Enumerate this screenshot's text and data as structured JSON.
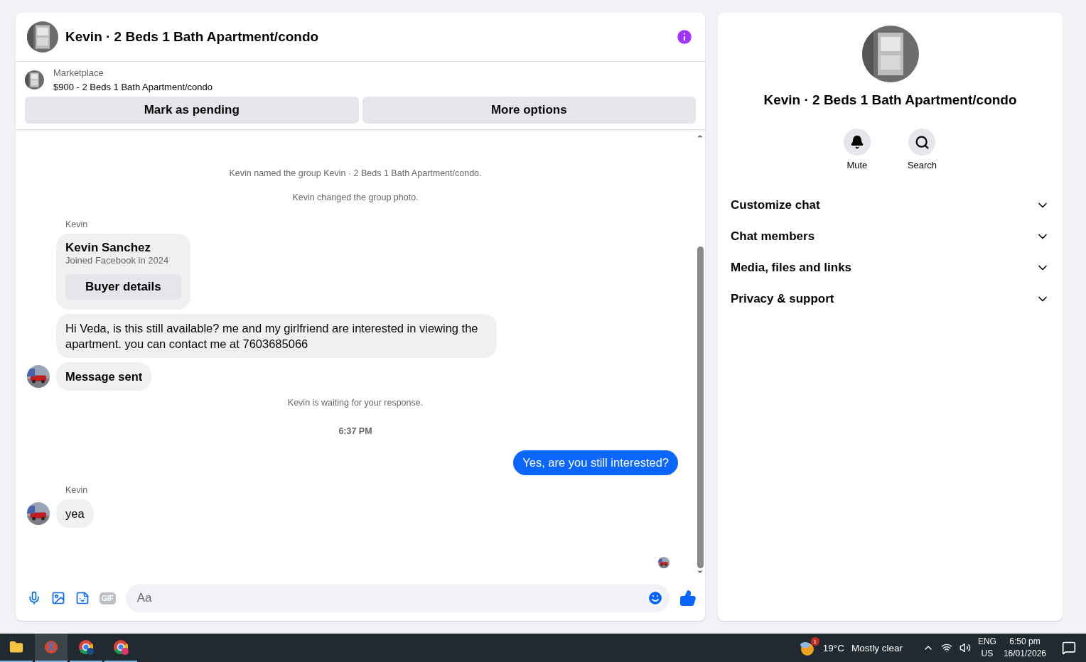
{
  "conversation": {
    "title": "Kevin · 2 Beds 1 Bath Apartment/condo",
    "listing": {
      "source": "Marketplace",
      "summary": "$900 - 2 Beds 1 Bath Apartment/condo"
    },
    "actions": [
      "Mark as pending",
      "More options"
    ],
    "messages": [
      {
        "kind": "notice",
        "text": "Kevin named the group Kevin · 2 Beds 1 Bath Apartment/condo."
      },
      {
        "kind": "notice",
        "text": "Kevin changed the group photo."
      },
      {
        "kind": "sender",
        "text": "Kevin"
      },
      {
        "kind": "profile",
        "name": "Kevin Sanchez",
        "detail": "Joined Facebook in 2024",
        "button": "Buyer details"
      },
      {
        "kind": "incoming",
        "text": "Hi Veda, is this still available? me and my girlfriend are interested in viewing the apartment. you can contact me at 7603685066",
        "avatar": false,
        "bold": false
      },
      {
        "kind": "incoming",
        "text": "Message sent",
        "avatar": true,
        "bold": true
      },
      {
        "kind": "notice",
        "text": "Kevin is waiting for your response."
      },
      {
        "kind": "time",
        "text": "6:37 PM"
      },
      {
        "kind": "outgoing",
        "text": "Yes, are you still interested?"
      },
      {
        "kind": "sender",
        "text": "Kevin"
      },
      {
        "kind": "incoming",
        "text": "yea",
        "avatar": true,
        "bold": false
      }
    ],
    "composer": {
      "gif_label": "GIF",
      "placeholder": "Aa"
    }
  },
  "details": {
    "title": "Kevin · 2 Beds 1 Bath Apartment/condo",
    "quick_actions": [
      {
        "kind": "mute",
        "label": "Mute"
      },
      {
        "kind": "search",
        "label": "Search"
      }
    ],
    "sections": [
      {
        "label": "Customize chat",
        "expanded": false
      },
      {
        "label": "Chat members",
        "expanded": false
      },
      {
        "label": "Media, files and links",
        "expanded": false
      },
      {
        "label": "Privacy & support",
        "expanded": false
      }
    ]
  },
  "taskbar": {
    "weather": {
      "badge": "1",
      "temperature": "19°C",
      "condition": "Mostly clear"
    },
    "language": "ENG",
    "region": "US",
    "time": "6:50 pm",
    "date": "16/01/2026"
  }
}
